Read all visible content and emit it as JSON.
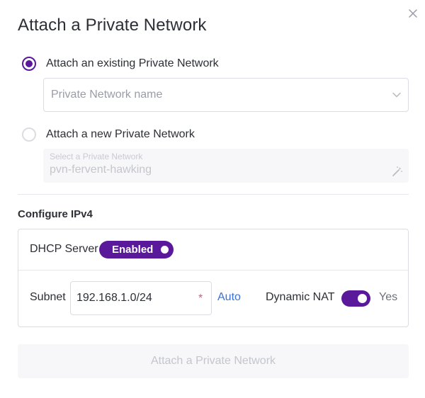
{
  "dialog": {
    "title": "Attach a Private Network",
    "close_icon": "close-icon"
  },
  "options": {
    "existing": {
      "label": "Attach an existing Private Network",
      "selected": true,
      "select_placeholder": "Private Network name"
    },
    "new": {
      "label": "Attach a new Private Network",
      "selected": false,
      "input_label": "Select a Private Network",
      "input_value": "pvn-fervent-hawking"
    }
  },
  "ipv4": {
    "section_title": "Configure IPv4",
    "dhcp": {
      "label": "DHCP Server",
      "status": "Enabled",
      "on": true
    },
    "subnet": {
      "label": "Subnet",
      "value": "192.168.1.0/24",
      "required_mark": "*",
      "auto_label": "Auto"
    },
    "nat": {
      "label": "Dynamic NAT",
      "on": true,
      "status": "Yes"
    }
  },
  "submit": {
    "label": "Attach a Private Network",
    "disabled": true
  },
  "colors": {
    "accent": "#5a189a",
    "link": "#3a73d6",
    "required": "#e5567d"
  }
}
